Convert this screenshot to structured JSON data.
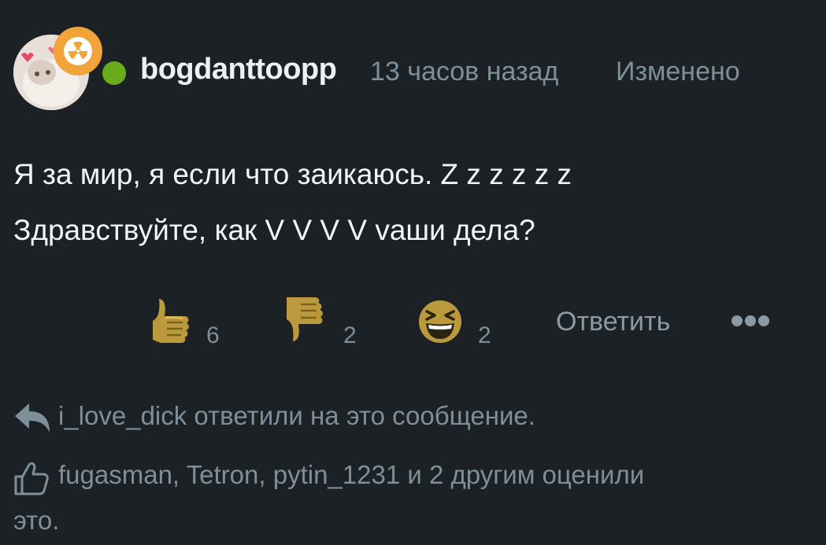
{
  "header": {
    "username": "bogdanttoopp",
    "time": "13 часов назад",
    "edited": "Изменено",
    "badge_icon": "radiation-icon",
    "online_color": "#6aab1c"
  },
  "body": {
    "line1": "Я за мир, я если что заикаюсь. Z z z z z z",
    "line2": "Здравствуйте, как V V V V vаши дела?"
  },
  "reactions": {
    "like": {
      "icon": "thumbs-up-icon",
      "count": "6"
    },
    "dislike": {
      "icon": "thumbs-down-icon",
      "count": "2"
    },
    "laugh": {
      "icon": "laughing-emoji-icon",
      "count": "2"
    },
    "reply_label": "Ответить",
    "more_icon": "more-dots-icon"
  },
  "notes": {
    "reply_note": "i_love_dick ответили на это сообщение.",
    "like_note_line1": "fugasman, Tetron, pytin_1231 и 2 другим оценили",
    "like_note_line2": "это."
  },
  "colors": {
    "background": "#1b2125",
    "text": "#f2f4f5",
    "muted": "#7e8f9a",
    "badge": "#f2a33a",
    "reaction_gold": "#bb9a3d"
  }
}
